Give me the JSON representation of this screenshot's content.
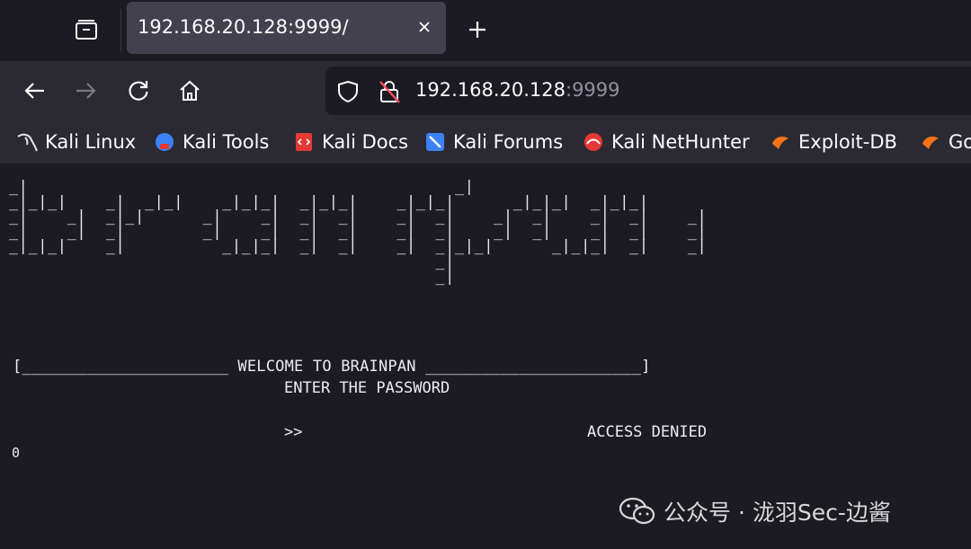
{
  "tab": {
    "title": "192.168.20.128:9999/"
  },
  "urlbar": {
    "host": "192.168.20.128",
    "port": ":9999"
  },
  "bookmarks": [
    {
      "label": "Kali Linux",
      "icon": "kali-dragon-icon"
    },
    {
      "label": "Kali Tools",
      "icon": "kali-tools-icon"
    },
    {
      "label": "Kali Docs",
      "icon": "kali-docs-icon"
    },
    {
      "label": "Kali Forums",
      "icon": "kali-forums-icon"
    },
    {
      "label": "Kali NetHunter",
      "icon": "kali-nethunter-icon"
    },
    {
      "label": "Exploit-DB",
      "icon": "exploit-db-icon"
    },
    {
      "label": "Go",
      "icon": "google-hacking-db-icon"
    }
  ],
  "page": {
    "ascii_banner": "_|                                            _|\n_|_|_|    _|  _|_|    _|_|_|  _|_|_|    _|_|_|      _|_|_|  _|_|_|\n_|    _|  _|_|      _|    _|  _|  _|    _|  _|    _|  _|    _|  _|    _|\n_|    _|  _|        _|    _|  _|  _|    _|  _|    _|  _|    _|  _|    _|\n_|_|_|    _|          _|_|_|  _|  _|    _|  _|_|_|      _|_|_|  _|    _|\n                                            _|\n                                            _|",
    "welcome_line": "[______________________ WELCOME TO BRAINPAN _______________________]",
    "enter_line": "ENTER THE PASSWORD",
    "prompt": ">>",
    "status": "ACCESS DENIED",
    "cursor_glyph": "0"
  },
  "watermark": {
    "text": "公众号 · 泷羽Sec-边酱"
  },
  "colors": {
    "chrome_dark": "#1c1b22",
    "toolbar": "#2b2a33",
    "active_tab": "#42414d",
    "text": "#fbfbfe",
    "muted": "#8f8f9d"
  }
}
